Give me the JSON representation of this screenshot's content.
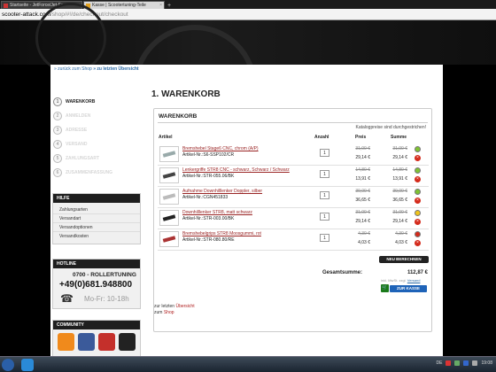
{
  "browser": {
    "tabs": [
      {
        "label": "Startseite - JetForce/Jet-Fo",
        "active": false
      },
      {
        "label": "Kasse | Scooter­tuning-Teile",
        "active": true
      }
    ],
    "url_host": "scooter-attack.com",
    "url_path": "/shop/#!/de/checkout/checkout"
  },
  "breadcrumb": {
    "back_shop": "» zurück zum Shop",
    "last_overview": "» zu letzten Übersicht"
  },
  "steps": [
    {
      "num": "1",
      "label": "Warenkorb",
      "active": true
    },
    {
      "num": "2",
      "label": "Anmelden",
      "active": false
    },
    {
      "num": "3",
      "label": "Adresse",
      "active": false
    },
    {
      "num": "4",
      "label": "Versand",
      "active": false
    },
    {
      "num": "5",
      "label": "Zahlungsart",
      "active": false
    },
    {
      "num": "6",
      "label": "Zusammenfassung",
      "active": false
    }
  ],
  "help": {
    "title": "HILFE",
    "items": [
      "Zahlungsarten",
      "Versandart",
      "Versandoptionen",
      "Versandkosten"
    ]
  },
  "hotline": {
    "title": "HOTLINE",
    "name": "0700 - ROLLERTUNING",
    "number": "+49(0)681.948800",
    "hours": "Mo-Fr: 10-18h"
  },
  "community": {
    "title": "COMMUNITY",
    "icons": [
      "rss-icon",
      "facebook-icon",
      "youtube-icon",
      "forum-icon"
    ]
  },
  "main": {
    "heading": "1. WARENKORB",
    "box_title": "WARENKORB",
    "note": "Katalogpreise sind durchgestrichen!",
    "headers": {
      "article": "Artikel",
      "qty": "Anzahl",
      "price": "Preis",
      "sum": "Summe"
    }
  },
  "cart_items": [
    {
      "name": "Bremshebel Stage6 CNC, chrom (A/P)",
      "number": "Artikel-Nr.:S6-SSP102/CR",
      "qty": "1",
      "price_old": "31,00 €",
      "price": "29,14 €",
      "sum_old": "31,00 €",
      "sum": "29,14 €",
      "status": "#7fc232"
    },
    {
      "name": "Lenkergriffe STR8 CNC - schwarz, Schwarz / Schwarz",
      "number": "Artikel-Nr.:STR-055.06/BK",
      "qty": "1",
      "price_old": "14,80 €",
      "price": "13,91 €",
      "sum_old": "14,80 €",
      "sum": "13,91 €",
      "status": "#7fc232"
    },
    {
      "name": "Aufnahme Downhilllenker Doppler, silber",
      "number": "Artikel-Nr.:CGN451833",
      "qty": "1",
      "price_old": "39,00 €",
      "price": "36,65 €",
      "sum_old": "39,00 €",
      "sum": "36,65 €",
      "status": "#7fc232"
    },
    {
      "name": "Downhilllenker STR8, matt schwarz",
      "number": "Artikel-Nr.:STR-003.00/BK",
      "qty": "1",
      "price_old": "31,00 €",
      "price": "29,14 €",
      "sum_old": "31,00 €",
      "sum": "29,14 €",
      "status": "#f0c419"
    },
    {
      "name": "Bremshebelgrips STR8 Moosgummi, rot",
      "number": "Artikel-Nr.:STR-080.80/RE",
      "qty": "1",
      "price_old": "4,30 €",
      "price": "4,03 €",
      "sum_old": "4,30 €",
      "sum": "4,03 €",
      "status": "#d42a1b"
    }
  ],
  "totals": {
    "recalc": "NEU BERECHNEN",
    "label": "Gesamtsumme:",
    "value": "112,87 €",
    "vat_prefix": "inkl. MwSt. zzgl.",
    "vat_link": "Versand",
    "checkout": "ZUR KASSE"
  },
  "links": {
    "last_prefix": "zur letzten",
    "last_link": "Übersicht",
    "shop_prefix": "zum",
    "shop_link": "Shop"
  },
  "taskbar": {
    "lang": "DE",
    "time": "19:08"
  }
}
